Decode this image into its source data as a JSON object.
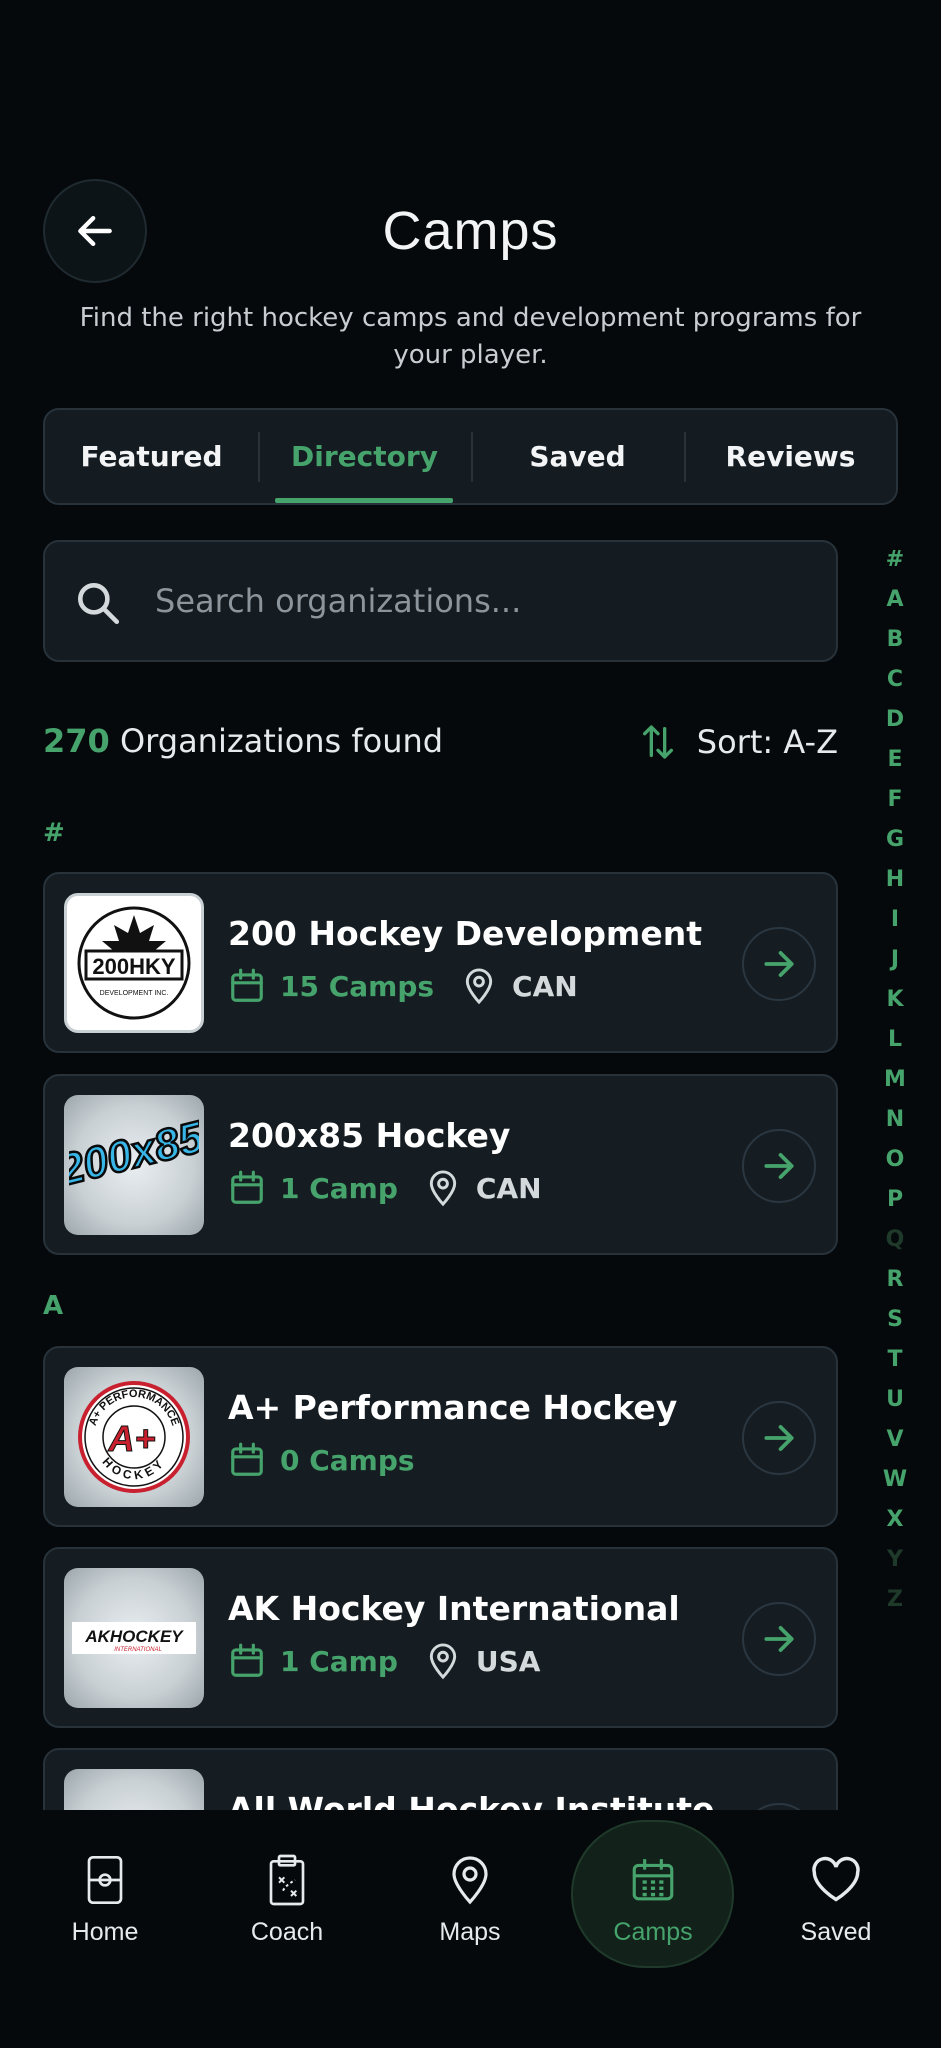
{
  "header": {
    "title": "Camps",
    "subtitle": "Find the right hockey camps and development programs for your player."
  },
  "tabs": [
    {
      "label": "Featured",
      "active": false
    },
    {
      "label": "Directory",
      "active": true
    },
    {
      "label": "Saved",
      "active": false
    },
    {
      "label": "Reviews",
      "active": false
    }
  ],
  "search": {
    "placeholder": "Search organizations..."
  },
  "results": {
    "count": "270",
    "label": "Organizations found",
    "sort": "Sort: A-Z"
  },
  "sections": {
    "hash": "#",
    "a": "A"
  },
  "organizations": [
    {
      "name": "200 Hockey Development",
      "camps": "15 Camps",
      "location": "CAN",
      "logo_text": "200HKY",
      "logo_subtext": "DEVELOPMENT INC."
    },
    {
      "name": "200x85 Hockey",
      "camps": "1 Camp",
      "location": "CAN",
      "logo_text": "200x85"
    },
    {
      "name": "A+ Performance Hockey",
      "camps": "0 Camps",
      "location": "",
      "logo_text": "A+",
      "logo_ring_top": "A+ PERFORMANCE",
      "logo_ring_bottom": "HOCKEY"
    },
    {
      "name": "AK Hockey International",
      "camps": "1 Camp",
      "location": "USA",
      "logo_text": "AKHOCKEY",
      "logo_subtext": "INTERNATIONAL"
    },
    {
      "name": "All World Hockey Institute",
      "camps": "",
      "location": ""
    }
  ],
  "alphabet": [
    "#",
    "A",
    "B",
    "C",
    "D",
    "E",
    "F",
    "G",
    "H",
    "I",
    "J",
    "K",
    "L",
    "M",
    "N",
    "O",
    "P",
    "Q",
    "R",
    "S",
    "T",
    "U",
    "V",
    "W",
    "X",
    "Y",
    "Z"
  ],
  "alphabet_disabled": [
    "Q",
    "Y",
    "Z"
  ],
  "nav": [
    {
      "label": "Home",
      "icon": "rink-icon"
    },
    {
      "label": "Coach",
      "icon": "clipboard-icon"
    },
    {
      "label": "Maps",
      "icon": "map-pin-icon"
    },
    {
      "label": "Camps",
      "icon": "calendar-icon",
      "active": true
    },
    {
      "label": "Saved",
      "icon": "heart-icon"
    }
  ],
  "colors": {
    "accent": "#45a36b",
    "background": "#05090b",
    "card": "#161d22",
    "border": "#27323a"
  }
}
